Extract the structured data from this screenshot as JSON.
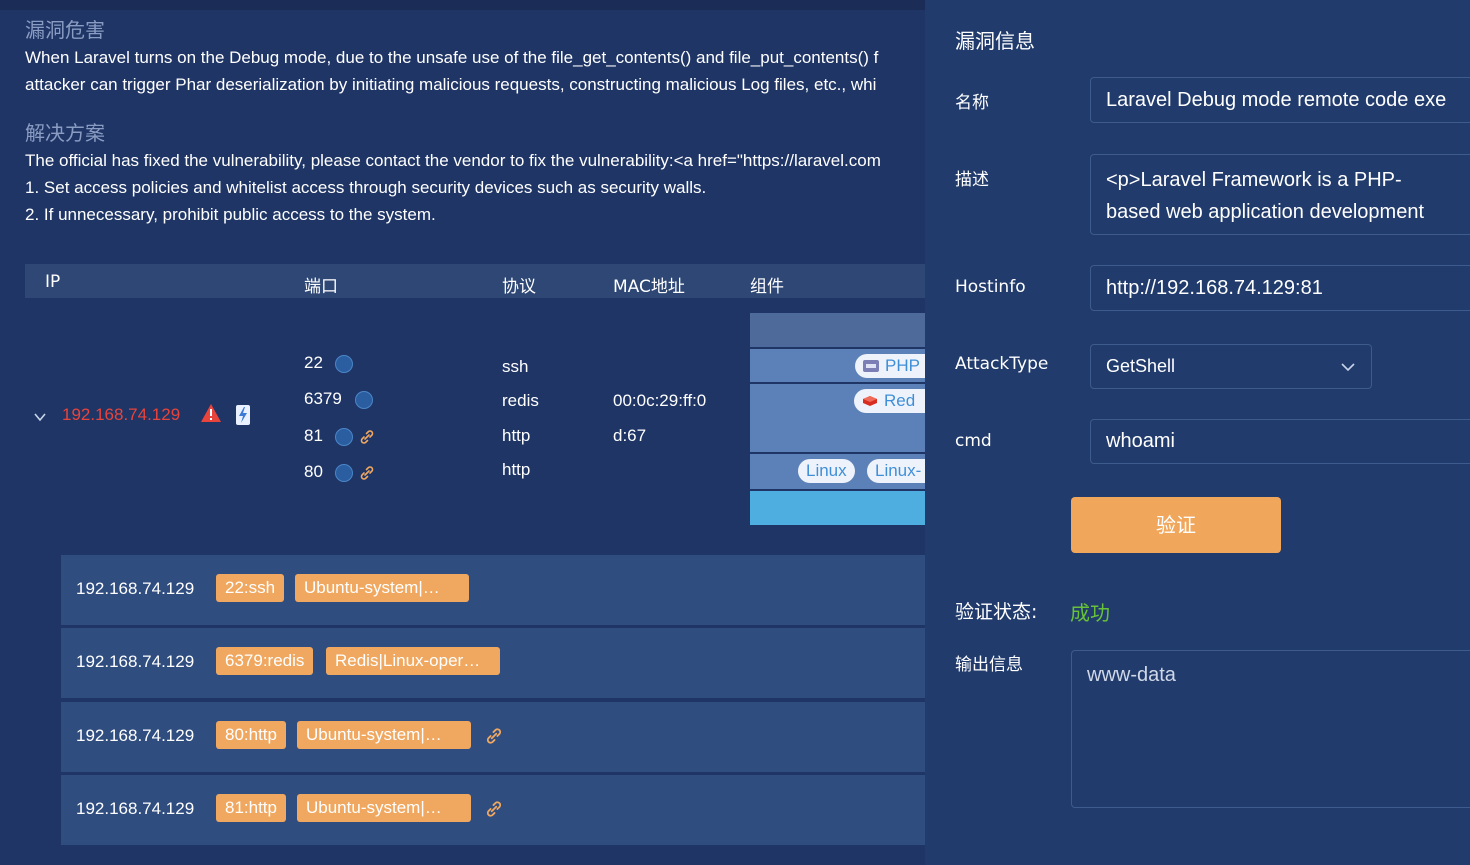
{
  "vuln": {
    "hazard_title": "漏洞危害",
    "hazard_line1": "When Laravel turns on the Debug mode, due to the unsafe use of the file_get_contents() and file_put_contents() f",
    "hazard_line2": "attacker can trigger Phar deserialization by initiating malicious requests, constructing malicious Log files, etc., whi",
    "solution_title": "解决方案",
    "solution_line1": "The official has fixed the vulnerability, please contact the vendor to fix the vulnerability:<a href=\"https://laravel.com",
    "solution_line2": "1. Set access policies and whitelist access through security devices such as security walls.",
    "solution_line3": "2. If unnecessary, prohibit public access to the system."
  },
  "table": {
    "headers": {
      "ip": "IP",
      "port": "端口",
      "protocol": "协议",
      "mac": "MAC地址",
      "component": "组件"
    },
    "host": {
      "ip": "192.168.74.129",
      "ports": [
        "22",
        "6379",
        "81",
        "80"
      ],
      "protocols": [
        "ssh",
        "redis",
        "http",
        "http"
      ],
      "mac_line1": "00:0c:29:ff:0",
      "mac_line2": "d:67",
      "components": [
        "PHP",
        "Red",
        "Linux",
        "Linux-"
      ]
    }
  },
  "rows": [
    {
      "ip": "192.168.74.129",
      "port_tag": "22:ssh",
      "comp_tag": "Ubuntu-system|…"
    },
    {
      "ip": "192.168.74.129",
      "port_tag": "6379:redis",
      "comp_tag": "Redis|Linux-oper…"
    },
    {
      "ip": "192.168.74.129",
      "port_tag": "80:http",
      "comp_tag": "Ubuntu-system|…"
    },
    {
      "ip": "192.168.74.129",
      "port_tag": "81:http",
      "comp_tag": "Ubuntu-system|…"
    }
  ],
  "drawer": {
    "title": "漏洞信息",
    "name_label": "名称",
    "name_value": "Laravel Debug mode remote code exe",
    "desc_label": "描述",
    "desc_line1": "<p>Laravel Framework is a PHP-",
    "desc_line2": "based web application development",
    "hostinfo_label": "Hostinfo",
    "hostinfo_value": "http://192.168.74.129:81",
    "attacktype_label": "AttackType",
    "attacktype_value": "GetShell",
    "cmd_label": "cmd",
    "cmd_value": "whoami",
    "verify_button": "验证",
    "status_label": "验证状态:",
    "status_value": "成功",
    "output_label": "输出信息",
    "output_value": "www-data"
  },
  "colors": {
    "background": "#1f3566",
    "host_ip_red": "#e8443b",
    "tag_orange": "#f0a860",
    "button_orange": "#f0a75b",
    "success_green": "#67c23a"
  }
}
